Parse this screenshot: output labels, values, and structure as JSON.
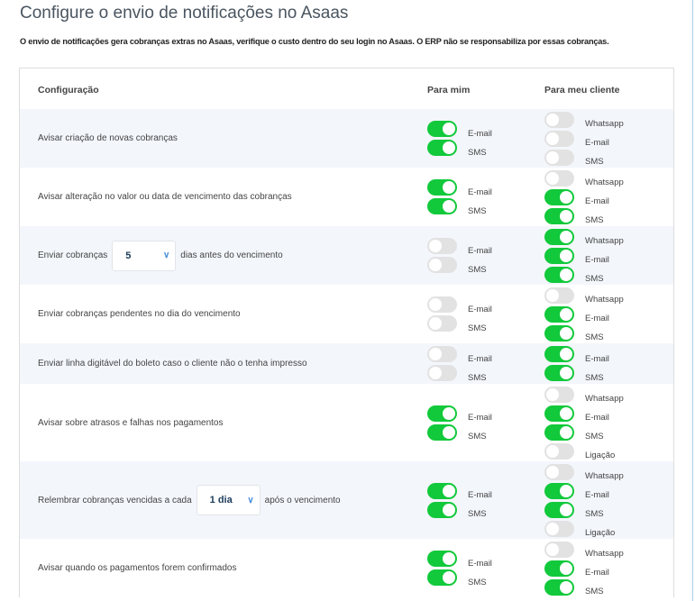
{
  "title": "Configure o envio de notificações no Asaas",
  "warning": "O envio de notificações gera cobranças extras no Asaas, verifique o custo dentro do seu login no Asaas. O ERP não se responsabiliza por essas cobranças.",
  "headers": {
    "config": "Configuração",
    "mim": "Para mim",
    "cliente": "Para meu cliente"
  },
  "colors": {
    "on": "#11c93b",
    "off": "#e2e2e2"
  },
  "rows": [
    {
      "label": "Avisar criação de novas cobranças",
      "mim": [
        {
          "label": "E-mail",
          "on": true
        },
        {
          "label": "SMS",
          "on": true
        }
      ],
      "cliente": [
        {
          "label": "Whatsapp",
          "on": false
        },
        {
          "label": "E-mail",
          "on": false
        },
        {
          "label": "SMS",
          "on": false
        }
      ]
    },
    {
      "label": "Avisar alteração no valor ou data de vencimento das cobranças",
      "mim": [
        {
          "label": "E-mail",
          "on": true
        },
        {
          "label": "SMS",
          "on": true
        }
      ],
      "cliente": [
        {
          "label": "Whatsapp",
          "on": false
        },
        {
          "label": "E-mail",
          "on": true
        },
        {
          "label": "SMS",
          "on": true
        }
      ]
    },
    {
      "label": "Enviar cobranças",
      "select": "5",
      "after": "dias antes do vencimento",
      "mim": [
        {
          "label": "E-mail",
          "on": false
        },
        {
          "label": "SMS",
          "on": false
        }
      ],
      "cliente": [
        {
          "label": "Whatsapp",
          "on": true
        },
        {
          "label": "E-mail",
          "on": true
        },
        {
          "label": "SMS",
          "on": true
        }
      ]
    },
    {
      "label": "Enviar cobranças pendentes no dia do vencimento",
      "mim": [
        {
          "label": "E-mail",
          "on": false
        },
        {
          "label": "SMS",
          "on": false
        }
      ],
      "cliente": [
        {
          "label": "Whatsapp",
          "on": false
        },
        {
          "label": "E-mail",
          "on": true
        },
        {
          "label": "SMS",
          "on": true
        }
      ]
    },
    {
      "label": "Enviar linha digitável do boleto caso o cliente não o tenha impresso",
      "mim": [
        {
          "label": "E-mail",
          "on": false
        },
        {
          "label": "SMS",
          "on": false
        }
      ],
      "cliente": [
        {
          "label": "E-mail",
          "on": true
        },
        {
          "label": "SMS",
          "on": true
        }
      ]
    },
    {
      "label": "Avisar sobre atrasos e falhas nos pagamentos",
      "mim": [
        {
          "label": "E-mail",
          "on": true
        },
        {
          "label": "SMS",
          "on": true
        }
      ],
      "cliente": [
        {
          "label": "Whatsapp",
          "on": false
        },
        {
          "label": "E-mail",
          "on": true
        },
        {
          "label": "SMS",
          "on": true
        },
        {
          "label": "Ligação",
          "on": false
        }
      ]
    },
    {
      "label": "Relembrar cobranças vencidas a cada",
      "select": "1 dia",
      "after": "após o vencimento",
      "mim": [
        {
          "label": "E-mail",
          "on": true
        },
        {
          "label": "SMS",
          "on": true
        }
      ],
      "cliente": [
        {
          "label": "Whatsapp",
          "on": false
        },
        {
          "label": "E-mail",
          "on": true
        },
        {
          "label": "SMS",
          "on": true
        },
        {
          "label": "Ligação",
          "on": false
        }
      ]
    },
    {
      "label": "Avisar quando os pagamentos forem confirmados",
      "mim": [
        {
          "label": "E-mail",
          "on": true
        },
        {
          "label": "SMS",
          "on": true
        }
      ],
      "cliente": [
        {
          "label": "Whatsapp",
          "on": false
        },
        {
          "label": "E-mail",
          "on": true
        },
        {
          "label": "SMS",
          "on": true
        }
      ]
    }
  ]
}
